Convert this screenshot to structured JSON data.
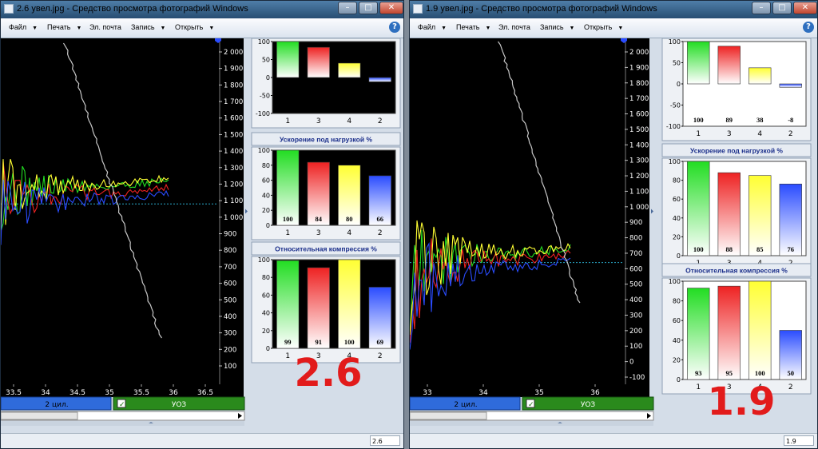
{
  "colors": {
    "green": "#22dd22",
    "red": "#ee2222",
    "yellow": "#ffff33",
    "blue": "#2a4cff",
    "accent_red": "#e21b1b",
    "tab_blue": "#2f6bdb",
    "tab_green": "#2a8a1c"
  },
  "windows": [
    {
      "id": "left",
      "title": "2.6 увел.jpg - Средство просмотра фотографий Windows",
      "menu": [
        "Файл",
        "Печать",
        "Эл. почта",
        "Запись",
        "Открыть"
      ],
      "value_label": "2.6",
      "status": "2.6",
      "x_ticks": [
        "33.5",
        "34",
        "34.5",
        "35",
        "35.5",
        "36",
        "36.5"
      ],
      "y_ticks": [
        "2 000",
        "1 900",
        "1 800",
        "1 700",
        "1 600",
        "1 500",
        "1 400",
        "1 300",
        "1 200",
        "1 100",
        "1 000",
        "900",
        "800",
        "700",
        "600",
        "500",
        "400",
        "300",
        "200",
        "100"
      ],
      "tab_left": "2 цил.",
      "tab_right": "УОЗ",
      "panel_balance": {
        "ticks": [
          "100",
          "50",
          "0",
          "-50",
          "-100"
        ],
        "cylinders": [
          "1",
          "3",
          "4",
          "2"
        ],
        "values": [
          100,
          84,
          40,
          -12
        ]
      },
      "panel_accel": {
        "title": "Ускорение под нагрузкой %",
        "ticks": [
          "100",
          "80",
          "60",
          "40",
          "20",
          "0"
        ],
        "cylinders": [
          "1",
          "3",
          "4",
          "2"
        ],
        "values": [
          100,
          84,
          80,
          66
        ]
      },
      "panel_comp": {
        "title": "Относительная компрессия %",
        "ticks": [
          "100",
          "80",
          "60",
          "40",
          "20",
          "0"
        ],
        "cylinders": [
          "1",
          "3",
          "4",
          "2"
        ],
        "values": [
          99,
          91,
          100,
          69
        ]
      }
    },
    {
      "id": "right",
      "title": "1.9 увел.jpg - Средство просмотра фотографий Windows",
      "menu": [
        "Файл",
        "Печать",
        "Эл. почта",
        "Запись",
        "Открыть"
      ],
      "value_label": "1.9",
      "status": "1.9",
      "x_ticks": [
        "33",
        "34",
        "35",
        "36"
      ],
      "y_ticks": [
        "2 000",
        "1 900",
        "1 800",
        "1 700",
        "1 600",
        "1 500",
        "1 400",
        "1 300",
        "1 200",
        "1 100",
        "1 000",
        "900",
        "800",
        "700",
        "600",
        "500",
        "400",
        "300",
        "200",
        "100",
        "0",
        "-100"
      ],
      "tab_left": "2 цил.",
      "tab_right": "УОЗ",
      "panel_balance": {
        "ticks": [
          "100",
          "50",
          "0",
          "-50",
          "-100"
        ],
        "cylinders": [
          "1",
          "3",
          "4",
          "2"
        ],
        "values": [
          100,
          89,
          38,
          -8
        ]
      },
      "panel_accel": {
        "title": "Ускорение под нагрузкой %",
        "ticks": [
          "100",
          "80",
          "60",
          "40",
          "20",
          "0"
        ],
        "cylinders": [
          "1",
          "3",
          "4",
          "2"
        ],
        "values": [
          100,
          88,
          85,
          76
        ]
      },
      "panel_comp": {
        "title": "Относительная компрессия %",
        "ticks": [
          "100",
          "80",
          "60",
          "40",
          "20",
          "0"
        ],
        "cylinders": [
          "1",
          "3",
          "4",
          "2"
        ],
        "values": [
          93,
          95,
          100,
          50
        ]
      }
    }
  ]
}
